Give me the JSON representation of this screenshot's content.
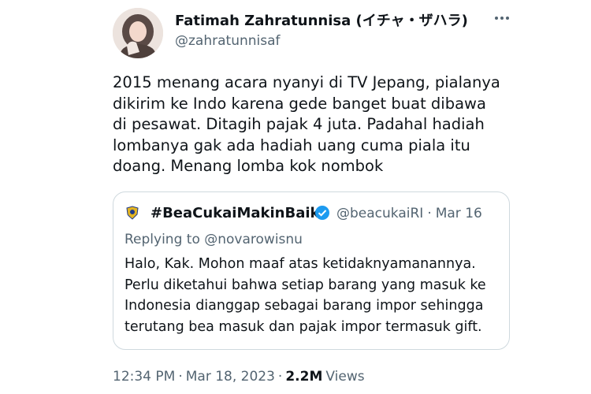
{
  "author": {
    "name": "Fatimah Zahratunnisa (イチャ・ザハラ)",
    "handle": "@zahratunnisaf"
  },
  "tweet": {
    "lines": [
      "2015 menang acara nyanyi di TV Jepang, pialanya",
      "dikirim ke Indo karena gede banget buat dibawa",
      "di pesawat. Ditagih pajak 4 juta. Padahal hadiah",
      "lombanya gak ada hadiah uang cuma piala itu",
      "doang. Menang lomba kok nombok"
    ]
  },
  "quote": {
    "name": "#BeaCukaiMakinBaik",
    "handle": "@beacukaiRI",
    "separator": "·",
    "date": "Mar 16",
    "replying_label": "Replying to",
    "replying_to": "@novarowisnu",
    "lines": [
      "Halo, Kak. Mohon maaf atas ketidaknyamanannya.",
      "Perlu diketahui bahwa setiap barang yang masuk ke",
      "Indonesia dianggap sebagai barang impor sehingga",
      "terutang bea masuk dan pajak impor termasuk gift."
    ]
  },
  "footer": {
    "time": "12:34 PM",
    "sep1": "·",
    "date": "Mar 18, 2023",
    "sep2": "·",
    "views_count": "2.2M",
    "views_label": "Views"
  },
  "icons": {
    "more": "more-horizontal-icon",
    "verified": "verified-badge-icon",
    "org_logo": "bea-cukai-logo-icon"
  },
  "colors": {
    "text": "#0f1419",
    "secondary": "#536471",
    "border": "#cfd9de",
    "verified": "#1d9bf0"
  }
}
